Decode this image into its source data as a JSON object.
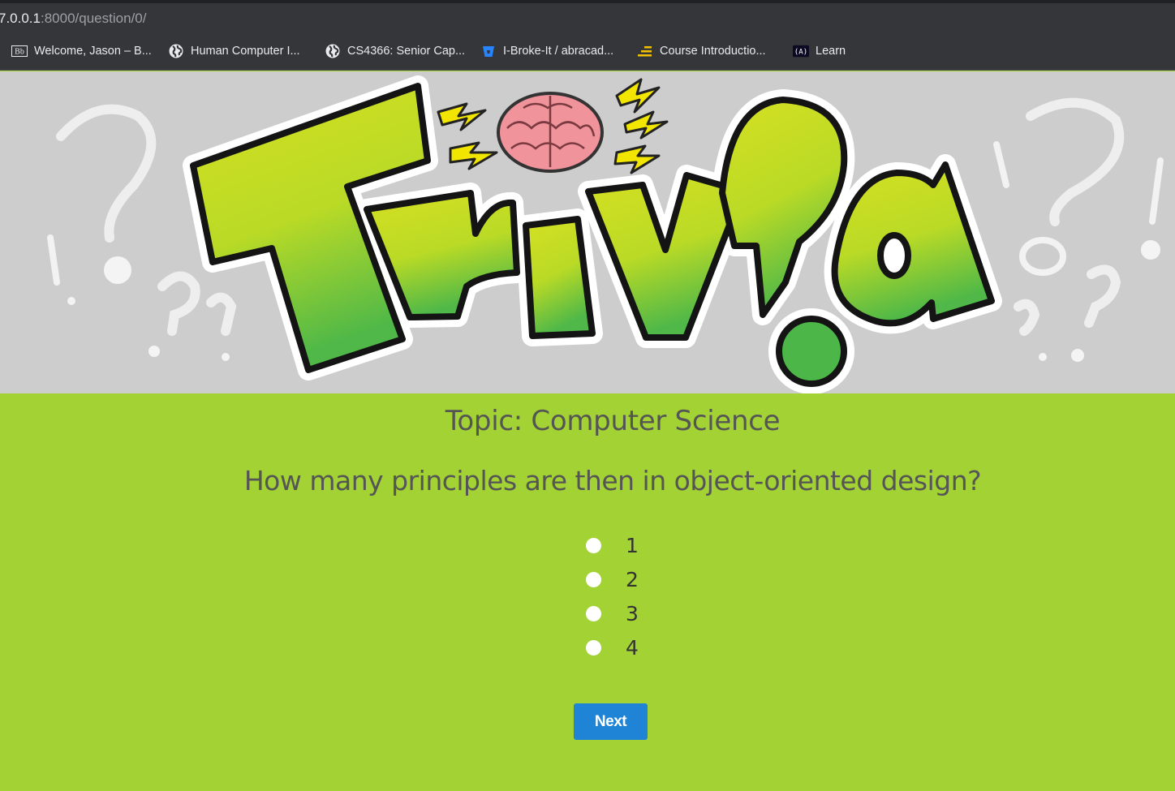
{
  "browser": {
    "url_host": "7.0.0.1",
    "url_path": ":8000/question/0/",
    "bookmarks": [
      {
        "label": "Welcome, Jason – B...",
        "icon": "blackboard-icon"
      },
      {
        "label": "Human Computer I...",
        "icon": "globe-icon"
      },
      {
        "label": "CS4366: Senior Cap...",
        "icon": "globe-icon"
      },
      {
        "label": "I-Broke-It / abracad...",
        "icon": "bitbucket-icon"
      },
      {
        "label": "Course Introductio...",
        "icon": "bars-icon"
      },
      {
        "label": "Learn",
        "icon": "freecodecamp-icon"
      }
    ]
  },
  "banner": {
    "logo_text": "Triv?a",
    "colors": {
      "background": "#cdcdcd",
      "letters_top": "#d6e021",
      "letters_bottom": "#4fb848",
      "brain": "#f0939b",
      "bolt": "#f2e600"
    }
  },
  "quiz": {
    "topic": "Topic: Computer Science",
    "question": "How many principles are then in object-oriented design?",
    "options": [
      "1",
      "2",
      "3",
      "4"
    ],
    "next_label": "Next",
    "colors": {
      "background": "#a2d233",
      "button": "#1f84d6",
      "text": "#555555"
    }
  }
}
